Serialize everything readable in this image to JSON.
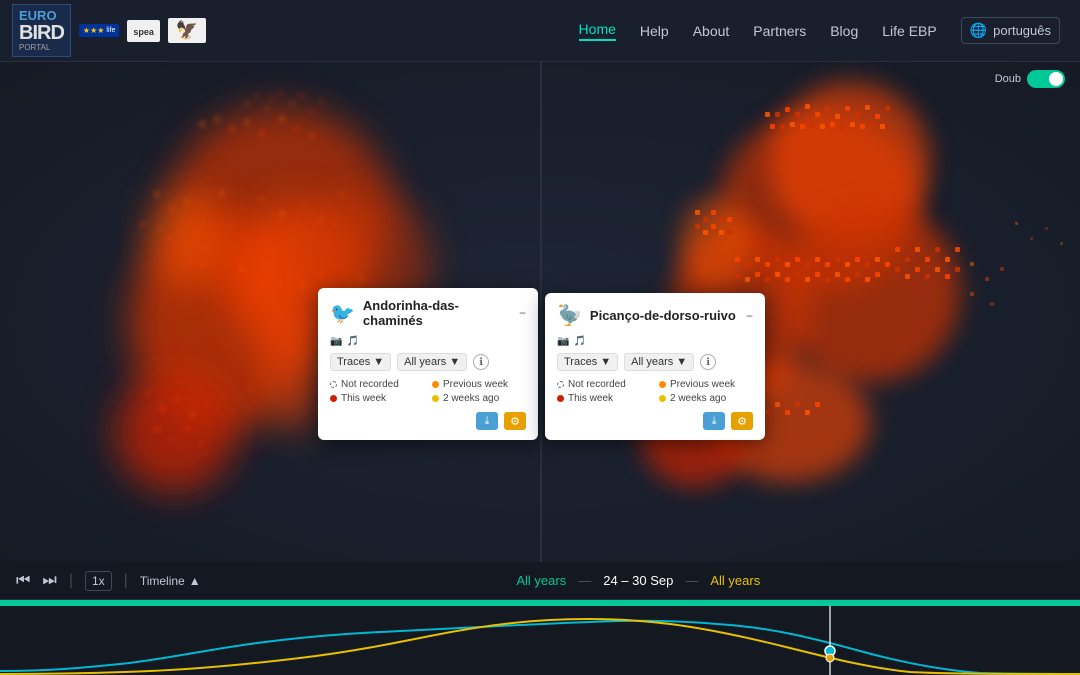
{
  "header": {
    "logo": {
      "main": "EURO",
      "bird": "BIRD",
      "portal": "PORTAL"
    },
    "nav": {
      "items": [
        {
          "label": "Home",
          "active": true
        },
        {
          "label": "Help",
          "active": false
        },
        {
          "label": "About",
          "active": false
        },
        {
          "label": "Partners",
          "active": false
        },
        {
          "label": "Blog",
          "active": false
        },
        {
          "label": "Life EBP",
          "active": false
        }
      ],
      "language": "português"
    }
  },
  "map": {
    "toggle_label": "Doub",
    "separator": true
  },
  "cards": [
    {
      "id": "card1",
      "title": "Andorinha-das-chaminés",
      "type_label": "Traces",
      "period_label": "All years",
      "legend": [
        {
          "dot": "empty",
          "label": "Not recorded"
        },
        {
          "dot": "orange",
          "label": "Previous week"
        },
        {
          "dot": "red",
          "label": "This week"
        },
        {
          "dot": "yellow",
          "label": "2 weeks ago"
        }
      ]
    },
    {
      "id": "card2",
      "title": "Picanço-de-dorso-ruivo",
      "type_label": "Traces",
      "period_label": "All years",
      "legend": [
        {
          "dot": "empty",
          "label": "Not recorded"
        },
        {
          "dot": "orange",
          "label": "Previous week"
        },
        {
          "dot": "red",
          "label": "This week"
        },
        {
          "dot": "yellow",
          "label": "2 weeks ago"
        }
      ]
    }
  ],
  "timeline": {
    "speed": "1x",
    "mode": "Timeline",
    "chevron": "▲",
    "center_text": {
      "left": "All years",
      "dash1": "—",
      "date": "24 – 30 Sep",
      "dash2": "—",
      "right": "All years"
    },
    "controls": {
      "rewind": "⏮",
      "skip": "⏭"
    }
  }
}
